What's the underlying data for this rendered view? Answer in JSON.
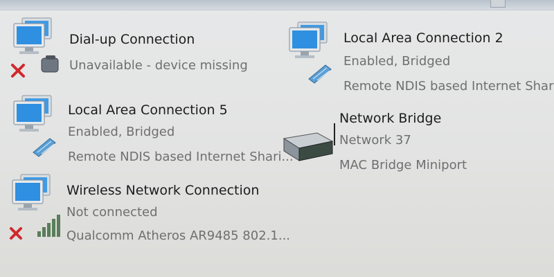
{
  "window": {
    "title_button_icon": "window-control-icon"
  },
  "connections": [
    {
      "name": "Dial-up Connection",
      "status": "Unavailable - device missing",
      "device": "",
      "icon": "dialup-computer-icon",
      "badge": "error-x-icon"
    },
    {
      "name": "Local Area Connection 2",
      "status": "Enabled, Bridged",
      "device": "Remote NDIS based Internet Shari...",
      "icon": "ethernet-computer-icon",
      "badge": ""
    },
    {
      "name": "Local Area Connection 5",
      "status": "Enabled, Bridged",
      "device": "Remote NDIS based Internet Shari...",
      "icon": "ethernet-computer-icon",
      "badge": ""
    },
    {
      "name": "Network Bridge",
      "status": "Network 37",
      "device": "MAC Bridge Miniport",
      "icon": "network-bridge-icon",
      "badge": ""
    },
    {
      "name": "Wireless Network Connection",
      "status": "Not connected",
      "device": "Qualcomm Atheros AR9485 802.1...",
      "icon": "wireless-computer-icon",
      "badge": "error-x-icon"
    }
  ],
  "colors": {
    "error_x": "#d0282c",
    "monitor_blue": "#3f9be6",
    "text_primary": "#1c1c1c",
    "text_secondary": "#6f6f6f"
  }
}
